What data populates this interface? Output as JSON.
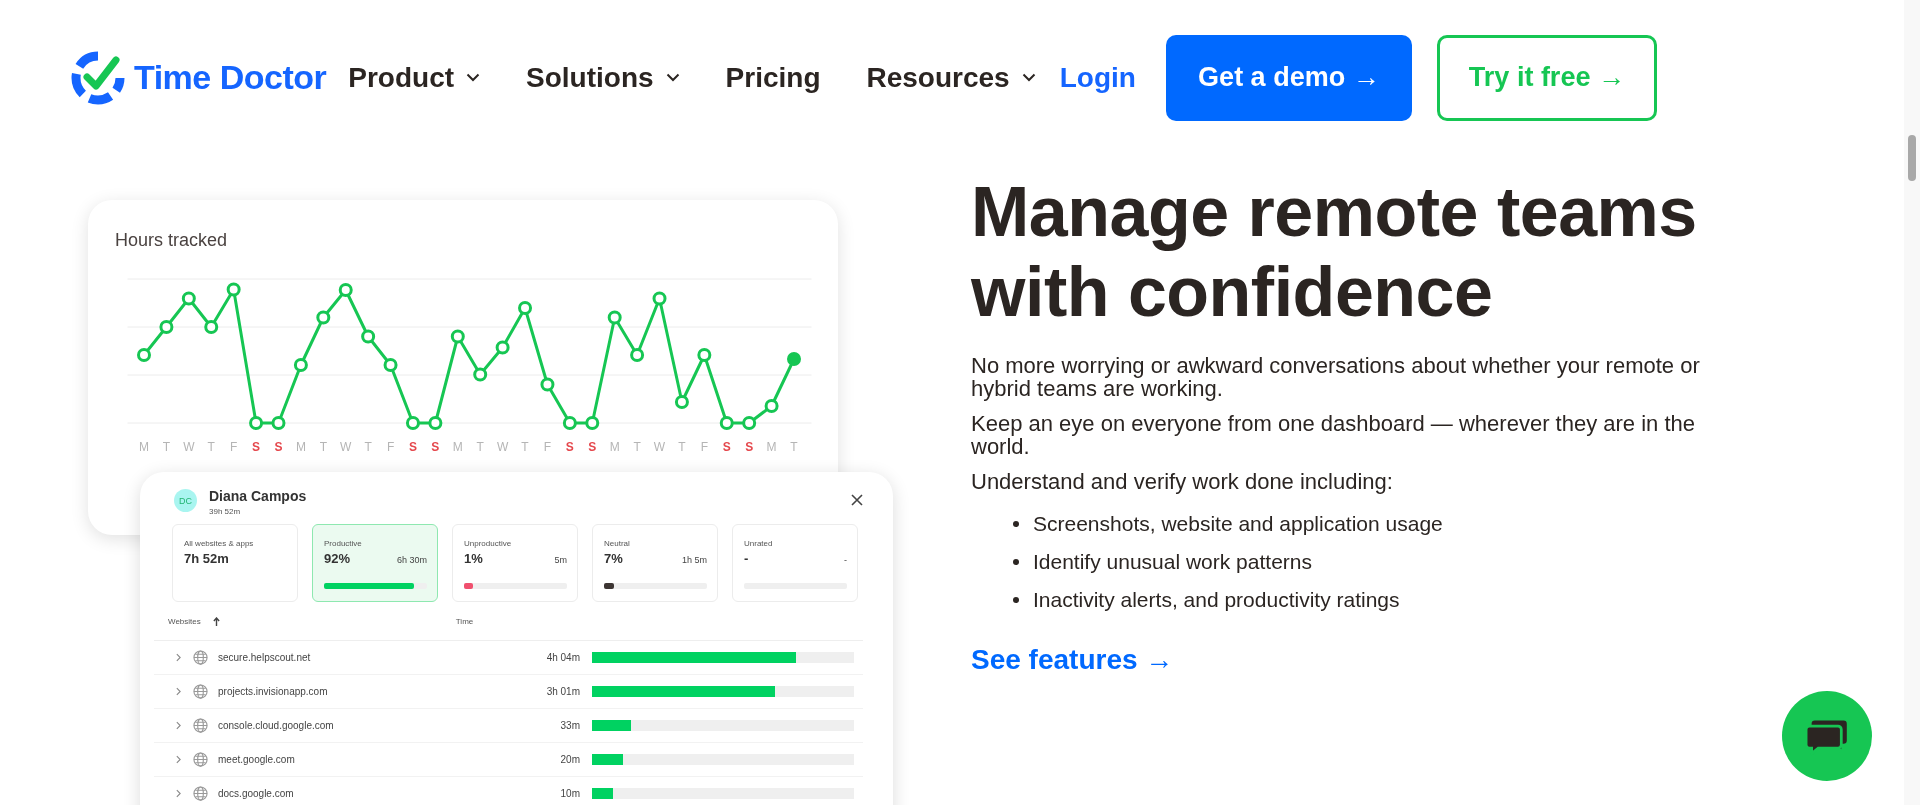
{
  "header": {
    "logo": "Time Doctor",
    "nav": [
      {
        "label": "Product",
        "has_menu": true
      },
      {
        "label": "Solutions",
        "has_menu": true
      },
      {
        "label": "Pricing",
        "has_menu": false
      },
      {
        "label": "Resources",
        "has_menu": true
      }
    ],
    "login": "Login",
    "buttons": [
      {
        "label": "Get a demo →",
        "kind": "primary"
      },
      {
        "label": "Try it free →",
        "kind": "outline"
      }
    ]
  },
  "chart_card": {
    "title": "Hours tracked",
    "days": [
      {
        "label": "M"
      },
      {
        "label": "T"
      },
      {
        "label": "W"
      },
      {
        "label": "T"
      },
      {
        "label": "F"
      },
      {
        "label": "S",
        "color": "#e5484d"
      },
      {
        "label": "S",
        "color": "#e5484d"
      },
      {
        "label": "M"
      },
      {
        "label": "T"
      },
      {
        "label": "W"
      },
      {
        "label": "T"
      },
      {
        "label": "F"
      },
      {
        "label": "S",
        "color": "#e5484d"
      },
      {
        "label": "S",
        "color": "#e5484d"
      },
      {
        "label": "M"
      },
      {
        "label": "T"
      },
      {
        "label": "W"
      },
      {
        "label": "T"
      },
      {
        "label": "F"
      },
      {
        "label": "S",
        "color": "#e5484d"
      },
      {
        "label": "S",
        "color": "#e5484d"
      },
      {
        "label": "M"
      },
      {
        "label": "T"
      },
      {
        "label": "W"
      },
      {
        "label": "T"
      },
      {
        "label": "F"
      },
      {
        "label": "S",
        "color": "#e5484d"
      },
      {
        "label": "S",
        "color": "#e5484d"
      },
      {
        "label": "M"
      },
      {
        "label": "T"
      }
    ]
  },
  "activity_panel": {
    "initials": "DC",
    "name": "Diana Campos",
    "total": "39h 52m",
    "stats": [
      {
        "kind": "total",
        "label": "All websites & apps",
        "value": "7h 52m",
        "selected": false
      },
      {
        "kind": "bar",
        "label": "Productive",
        "value": "92%",
        "time": "6h 30m",
        "level": 0.87,
        "color": "#00d261",
        "selected": true
      },
      {
        "kind": "bar",
        "label": "Unproductive",
        "value": "1%",
        "time": "5m",
        "level": 0.09,
        "color": "#f0506e",
        "selected": false
      },
      {
        "kind": "bar",
        "label": "Neutral",
        "value": "7%",
        "time": "1h 5m",
        "level": 0.1,
        "color": "#3d3533",
        "selected": false
      },
      {
        "kind": "bar",
        "label": "Unrated",
        "value": "-",
        "time": "-",
        "selected": false
      }
    ],
    "columns": [
      "Websites",
      "Time"
    ],
    "rows": [
      {
        "site": "secure.helpscout.net",
        "time": "4h 04m",
        "level": 0.78
      },
      {
        "site": "projects.invisionapp.com",
        "time": "3h 01m",
        "level": 0.7
      },
      {
        "site": "console.cloud.google.com",
        "time": "33m",
        "level": 0.15
      },
      {
        "site": "meet.google.com",
        "time": "20m",
        "level": 0.12
      },
      {
        "site": "docs.google.com",
        "time": "10m",
        "level": 0.08
      }
    ]
  },
  "hero": {
    "heading": "Manage remote teams with confidence",
    "paragraphs": [
      "No more worrying or awkward conversations about whether your remote or hybrid teams are working.",
      "Keep an eye on everyone from one dashboard — wherever they are in the world.",
      "Understand and verify work done including:"
    ],
    "bullets": [
      "Screenshots, website and application usage",
      "Identify unusual work patterns",
      "Inactivity alerts, and productivity ratings"
    ],
    "link": "See features →"
  }
}
